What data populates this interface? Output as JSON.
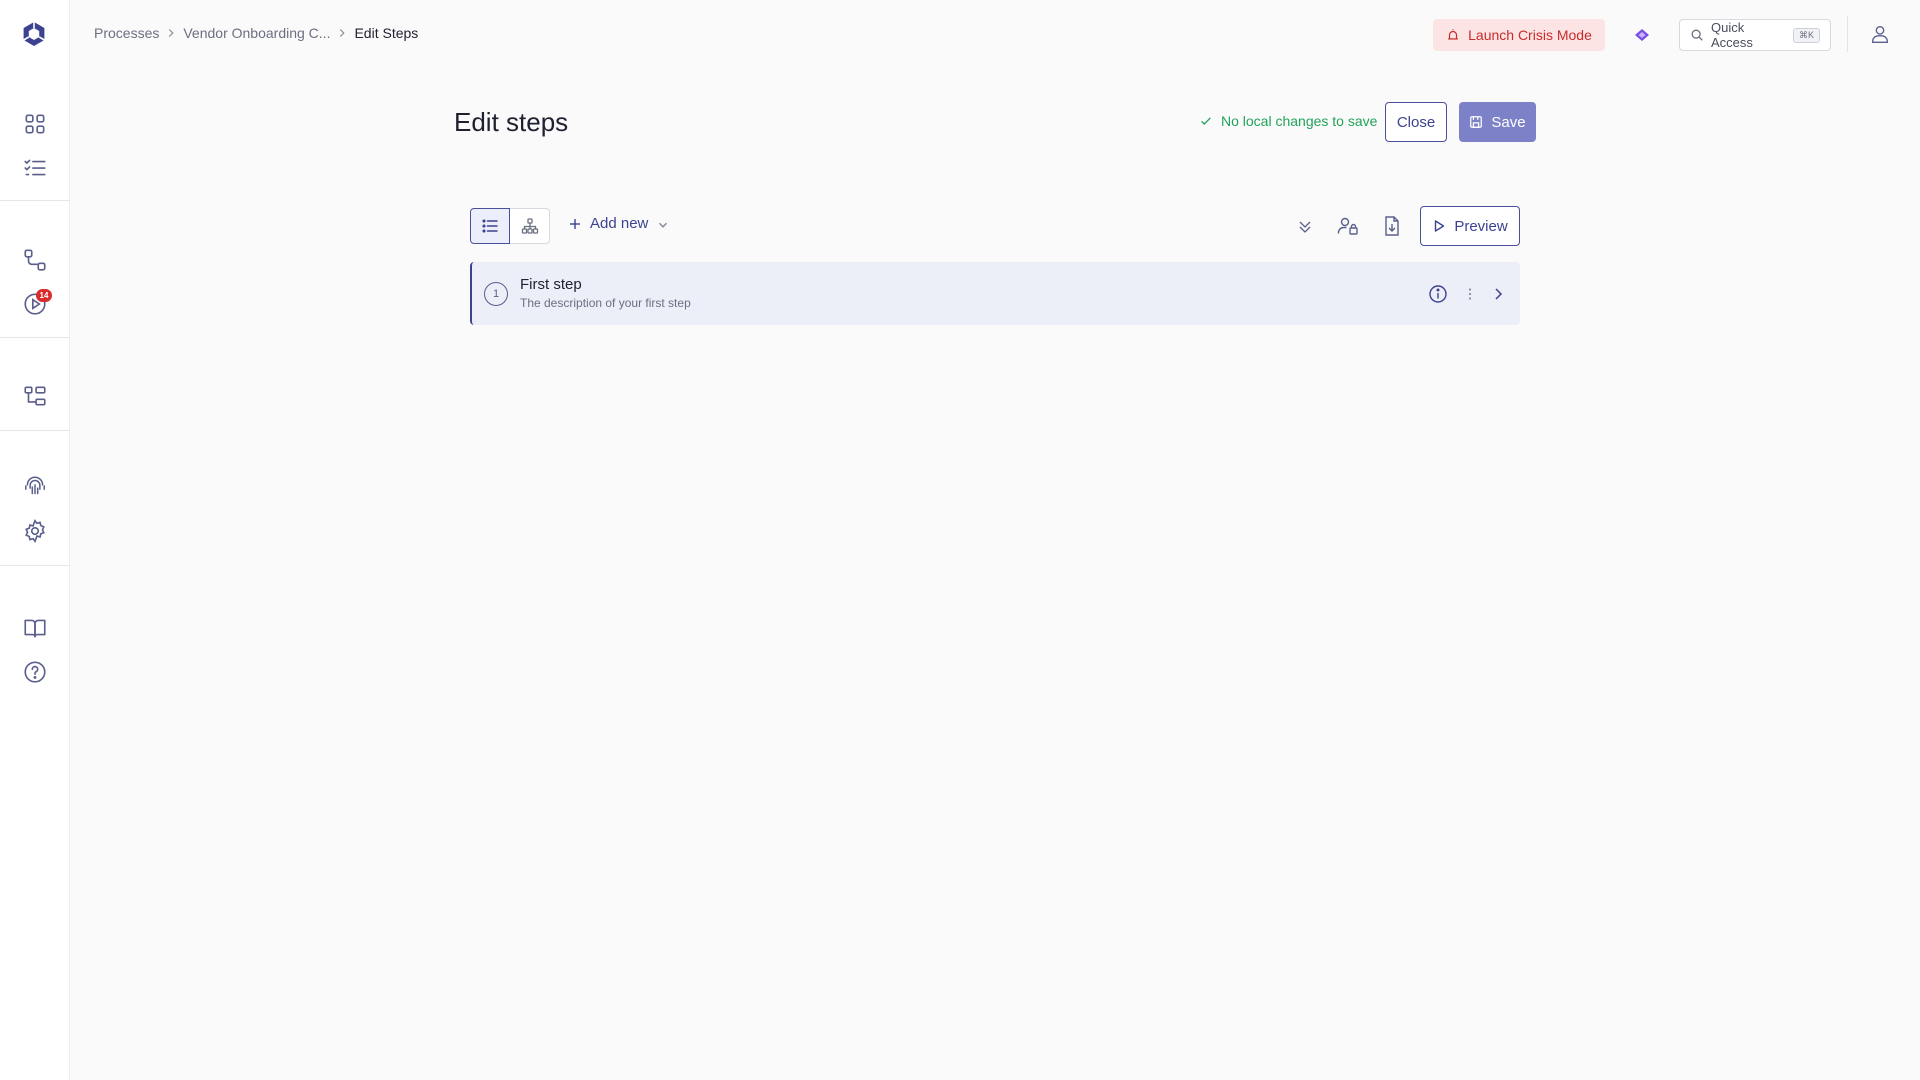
{
  "sidebar": {
    "logo": "app-logo",
    "items": [
      {
        "name": "dashboard-icon"
      },
      {
        "name": "checklist-icon"
      },
      {
        "name": "processes-icon"
      },
      {
        "name": "runs-icon",
        "badge": "14"
      },
      {
        "name": "hierarchy-icon"
      },
      {
        "name": "fingerprint-icon"
      },
      {
        "name": "settings-icon"
      },
      {
        "name": "docs-book-icon"
      },
      {
        "name": "help-icon"
      }
    ]
  },
  "breadcrumb": {
    "items": [
      "Processes",
      "Vendor Onboarding C...",
      "Edit Steps"
    ]
  },
  "topbar": {
    "crisis_label": "Launch Crisis Mode",
    "quick_access_label": "Quick Access",
    "quick_access_shortcut": "⌘K"
  },
  "header": {
    "title": "Edit steps",
    "status": "No local changes to save",
    "close_label": "Close",
    "save_label": "Save"
  },
  "toolbar": {
    "add_new_label": "Add new",
    "preview_label": "Preview"
  },
  "steps": [
    {
      "number": "1",
      "title": "First step",
      "description": "The description of your first step"
    }
  ],
  "colors": {
    "accent": "#3d4290",
    "save_button": "#7d82c8",
    "crisis_bg": "#fde4e4",
    "crisis_text": "#c72c2c",
    "success": "#22a35a",
    "badge": "#d92b2b",
    "step_row_bg": "#eceef8"
  }
}
